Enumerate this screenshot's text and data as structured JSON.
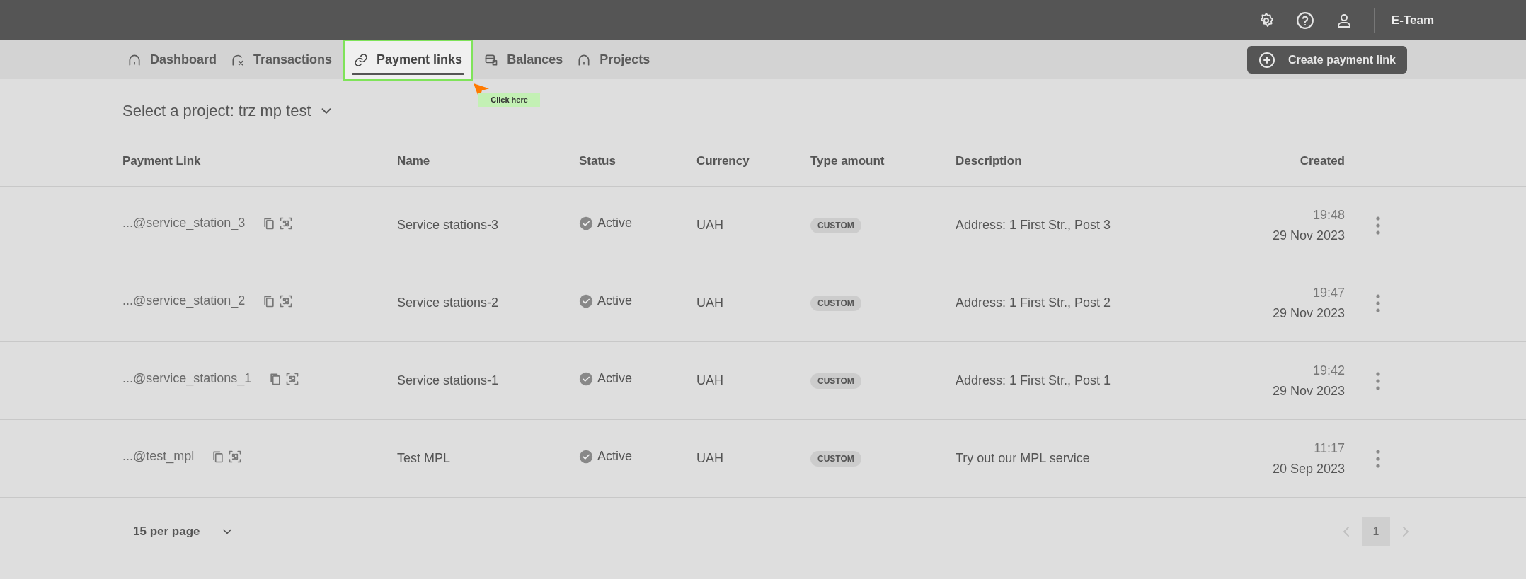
{
  "top_bar": {
    "account": "E-Team"
  },
  "tabs": [
    {
      "label": "Dashboard",
      "selected": false
    },
    {
      "label": "Transactions",
      "selected": false
    },
    {
      "label": "Payment links",
      "selected": true
    },
    {
      "label": "Balances",
      "selected": false
    },
    {
      "label": "Projects",
      "selected": false
    }
  ],
  "create_button": "Create payment link",
  "tooltip": "Click here",
  "project_select": "Select a project: trz mp test",
  "table": {
    "columns": [
      "Payment Link",
      "Name",
      "Status",
      "Currency",
      "Type amount",
      "Description",
      "Created"
    ],
    "rows": [
      {
        "link": "...@service_station_3",
        "name": "Service stations-3",
        "status": "Active",
        "currency": "UAH",
        "type": "CUSTOM",
        "description": "Address: 1 First Str., Post 3",
        "time": "19:48",
        "date": "29 Nov 2023"
      },
      {
        "link": "...@service_station_2",
        "name": "Service stations-2",
        "status": "Active",
        "currency": "UAH",
        "type": "CUSTOM",
        "description": "Address: 1 First Str., Post 2",
        "time": "19:47",
        "date": "29 Nov 2023"
      },
      {
        "link": "...@service_stations_1",
        "name": "Service stations-1",
        "status": "Active",
        "currency": "UAH",
        "type": "CUSTOM",
        "description": "Address: 1 First Str., Post 1",
        "time": "19:42",
        "date": "29 Nov 2023"
      },
      {
        "link": "...@test_mpl",
        "name": "Test MPL",
        "status": "Active",
        "currency": "UAH",
        "type": "CUSTOM",
        "description": "Try out our MPL service",
        "time": "11:17",
        "date": "20 Sep 2023"
      }
    ]
  },
  "pagination": {
    "per_page": "15 per page",
    "pages": [
      {
        "label": "1",
        "selected": true
      }
    ]
  }
}
